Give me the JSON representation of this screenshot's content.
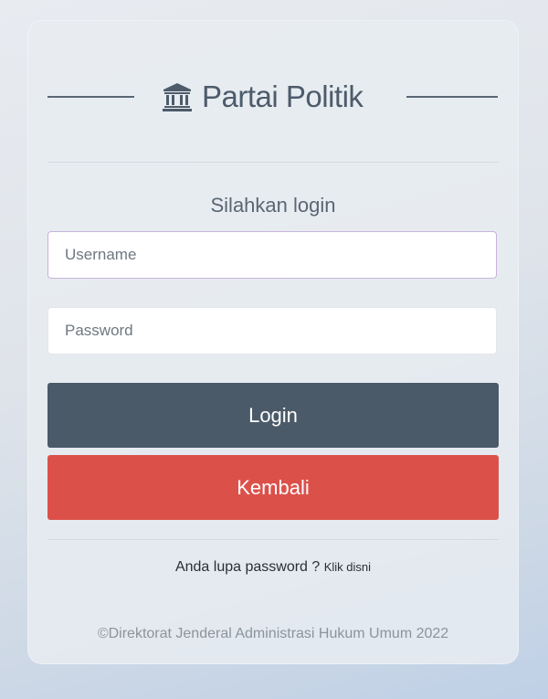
{
  "header": {
    "brand_icon": "bank-building-icon",
    "title": "Partai Politik"
  },
  "login": {
    "prompt": "Silahkan login",
    "username": {
      "placeholder": "Username",
      "value": ""
    },
    "password": {
      "placeholder": "Password",
      "value": ""
    },
    "login_label": "Login",
    "back_label": "Kembali",
    "forgot_text": "Anda lupa password ? ",
    "forgot_link": "Klik disni"
  },
  "footer": {
    "copyright": "©Direktorat Jenderal Administrasi Hukum Umum 2022"
  },
  "colors": {
    "login_button": "#4b5a69",
    "back_button": "#db514a",
    "brand_text": "#4d5b6a"
  }
}
